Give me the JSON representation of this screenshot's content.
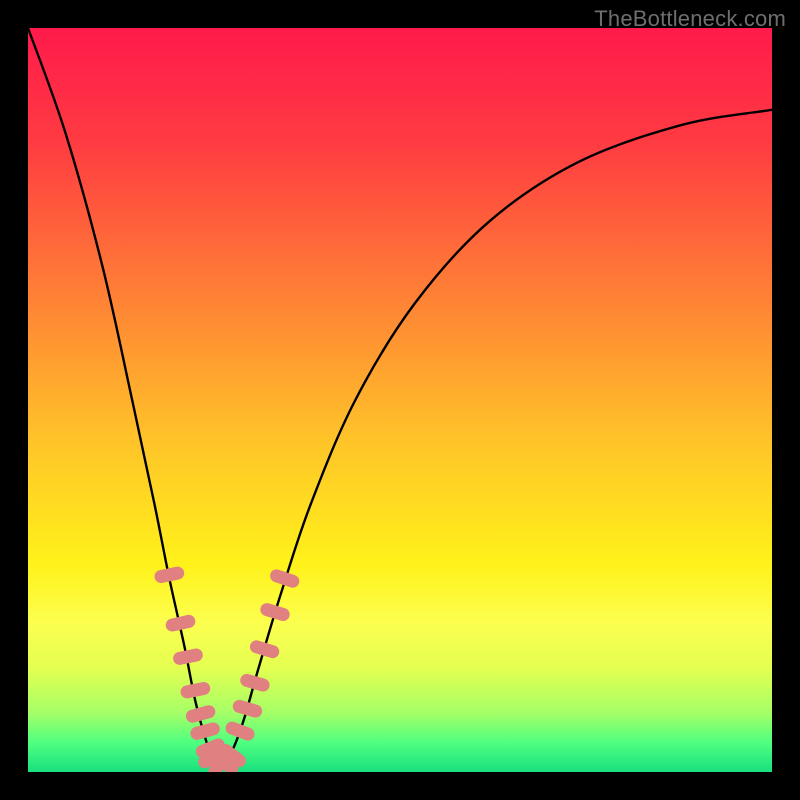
{
  "watermark": "TheBottleneck.com",
  "colors": {
    "frame": "#000000",
    "curve": "#000000",
    "markers": "#e08080",
    "gradient_stops": [
      {
        "offset": 0.0,
        "color": "#ff1a4b"
      },
      {
        "offset": 0.15,
        "color": "#ff3a42"
      },
      {
        "offset": 0.35,
        "color": "#ff7d36"
      },
      {
        "offset": 0.55,
        "color": "#ffc229"
      },
      {
        "offset": 0.72,
        "color": "#fff21a"
      },
      {
        "offset": 0.8,
        "color": "#fcff4f"
      },
      {
        "offset": 0.86,
        "color": "#e4ff50"
      },
      {
        "offset": 0.92,
        "color": "#a6ff66"
      },
      {
        "offset": 0.96,
        "color": "#50ff80"
      },
      {
        "offset": 1.0,
        "color": "#18e07f"
      }
    ]
  },
  "chart_data": {
    "type": "line",
    "title": "",
    "xlabel": "",
    "ylabel": "",
    "xlim": [
      0,
      1
    ],
    "ylim": [
      0,
      1
    ],
    "note": "Axes are normalized (no tick labels are rendered in the image). y represents a bottleneck metric where 0 is optimal (green) and 1 is worst (red). The curve has a sharp minimum near x≈0.25.",
    "series": [
      {
        "name": "bottleneck-curve",
        "x": [
          0.0,
          0.05,
          0.1,
          0.14,
          0.17,
          0.19,
          0.21,
          0.225,
          0.24,
          0.25,
          0.26,
          0.275,
          0.29,
          0.31,
          0.34,
          0.38,
          0.44,
          0.52,
          0.62,
          0.74,
          0.88,
          1.0
        ],
        "y": [
          1.0,
          0.86,
          0.68,
          0.5,
          0.36,
          0.26,
          0.17,
          0.095,
          0.04,
          0.015,
          0.01,
          0.03,
          0.07,
          0.14,
          0.24,
          0.36,
          0.5,
          0.63,
          0.74,
          0.82,
          0.87,
          0.89
        ]
      },
      {
        "name": "markers-left",
        "type": "scatter",
        "x": [
          0.19,
          0.205,
          0.215,
          0.225,
          0.232,
          0.238,
          0.245
        ],
        "y": [
          0.265,
          0.2,
          0.155,
          0.11,
          0.078,
          0.055,
          0.032
        ]
      },
      {
        "name": "markers-bottom",
        "type": "scatter",
        "x": [
          0.248,
          0.256,
          0.265,
          0.275
        ],
        "y": [
          0.018,
          0.01,
          0.012,
          0.022
        ]
      },
      {
        "name": "markers-right",
        "type": "scatter",
        "x": [
          0.285,
          0.295,
          0.305,
          0.318,
          0.332,
          0.345
        ],
        "y": [
          0.055,
          0.085,
          0.12,
          0.165,
          0.215,
          0.26
        ]
      }
    ]
  }
}
